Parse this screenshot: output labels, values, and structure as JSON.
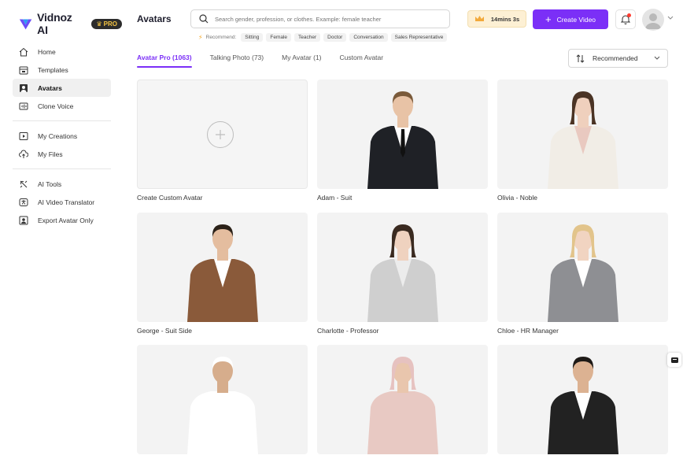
{
  "app": {
    "name": "Vidnoz AI",
    "pro_label": "PRO"
  },
  "sidebar": {
    "groups": [
      [
        {
          "label": "Home",
          "icon": "home-icon"
        },
        {
          "label": "Templates",
          "icon": "templates-icon"
        },
        {
          "label": "Avatars",
          "icon": "avatar-icon",
          "active": true
        },
        {
          "label": "Clone Voice",
          "icon": "voice-icon"
        }
      ],
      [
        {
          "label": "My Creations",
          "icon": "play-icon"
        },
        {
          "label": "My Files",
          "icon": "cloud-upload-icon"
        }
      ],
      [
        {
          "label": "AI Tools",
          "icon": "tools-icon"
        },
        {
          "label": "AI Video Translator",
          "icon": "translate-icon"
        },
        {
          "label": "Export Avatar Only",
          "icon": "export-avatar-icon"
        }
      ]
    ]
  },
  "header": {
    "title": "Avatars",
    "search_placeholder": "Search gender, profession, or clothes. Example: female teacher",
    "recommend_label": "Recommend:",
    "recommend_chips": [
      "Sitting",
      "Female",
      "Teacher",
      "Doctor",
      "Conversation",
      "Sales Representative"
    ],
    "timer": "14mins 3s",
    "create_label": "Create Video"
  },
  "tabs": [
    {
      "label": "Avatar Pro (1063)",
      "active": true
    },
    {
      "label": "Talking Photo (73)"
    },
    {
      "label": "My Avatar (1)"
    },
    {
      "label": "Custom Avatar"
    }
  ],
  "sort": {
    "label": "Recommended"
  },
  "cards": [
    {
      "caption": "Create Custom Avatar",
      "kind": "add"
    },
    {
      "caption": "Adam - Suit",
      "kind": "male",
      "suit": "#1f2126",
      "shirt": "#ffffff",
      "tie": "#111111",
      "hair": "#7a5a3a",
      "skin": "#e8c3a6"
    },
    {
      "caption": "Olivia - Noble",
      "kind": "female",
      "suit": "#f1ede6",
      "shirt": "#e9c9c0",
      "hair": "#4a3324",
      "skin": "#efd0bd"
    },
    {
      "caption": "George - Suit Side",
      "kind": "male",
      "suit": "#8a5a3a",
      "shirt": "#ffffff",
      "tie": "",
      "hair": "#2b2118",
      "skin": "#e4bd9f"
    },
    {
      "caption": "Charlotte - Professor",
      "kind": "female",
      "suit": "#cfcfcf",
      "shirt": "#ececec",
      "hair": "#3a2a20",
      "skin": "#efd2bf"
    },
    {
      "caption": "Chloe - HR Manager",
      "kind": "female",
      "suit": "#8e8f93",
      "shirt": "#ffffff",
      "hair": "#e2c48b",
      "skin": "#f1d4c1"
    },
    {
      "caption": "",
      "kind": "male",
      "suit": "#ffffff",
      "shirt": "#ffffff",
      "tie": "",
      "hair": "#ffffff",
      "skin": "#d6ad8c"
    },
    {
      "caption": "",
      "kind": "female",
      "suit": "#e8c9c3",
      "shirt": "#e8c9c3",
      "hair": "#e6c2c0",
      "skin": "#e9c6ad"
    },
    {
      "caption": "",
      "kind": "male",
      "suit": "#222222",
      "shirt": "#ffffff",
      "tie": "",
      "hair": "#1e1a17",
      "skin": "#dcb292"
    }
  ]
}
